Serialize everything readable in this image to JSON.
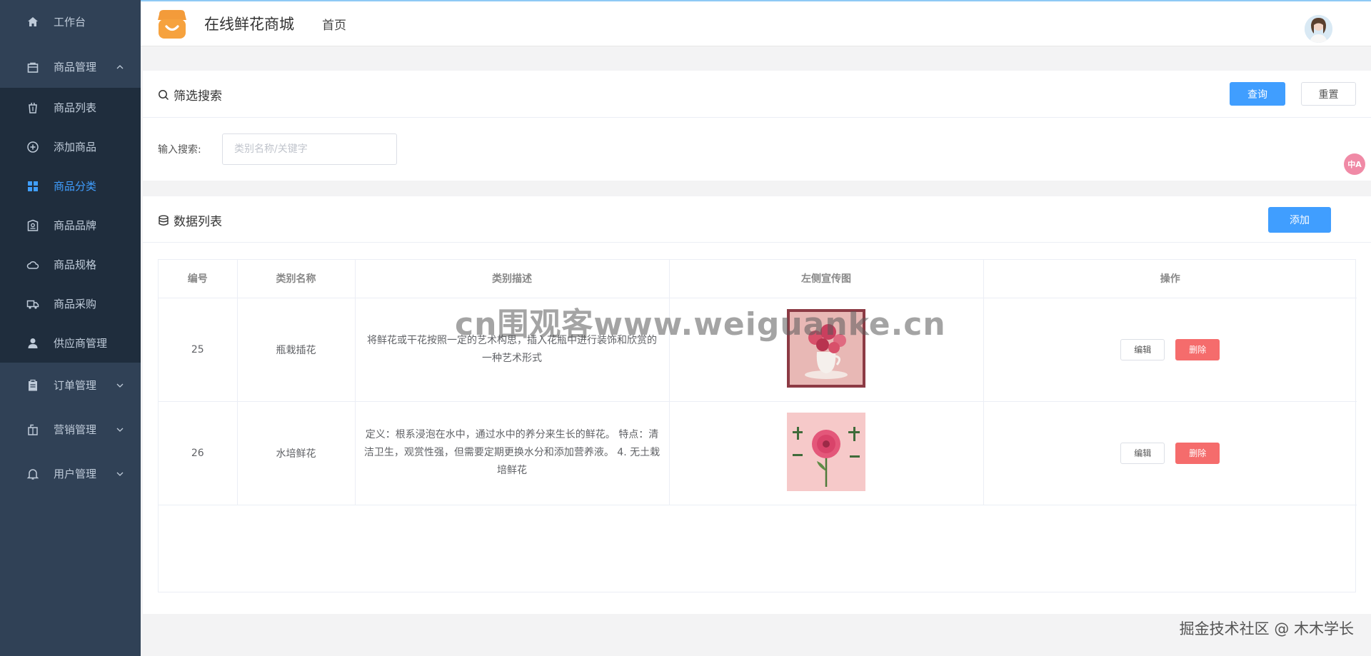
{
  "sidebar": {
    "top_items": [
      {
        "label": "工作台",
        "icon": "home-icon"
      },
      {
        "label": "商品管理",
        "icon": "shopping-bag-icon"
      }
    ],
    "sub_items": [
      {
        "label": "商品列表",
        "icon": "trash-bag-icon"
      },
      {
        "label": "添加商品",
        "icon": "plus-circle-icon"
      },
      {
        "label": "商品分类",
        "icon": "grid-icon",
        "active": true
      },
      {
        "label": "商品品牌",
        "icon": "badge-icon"
      },
      {
        "label": "商品规格",
        "icon": "cloud-icon"
      },
      {
        "label": "商品采购",
        "icon": "truck-icon"
      },
      {
        "label": "供应商管理",
        "icon": "user-icon"
      }
    ],
    "bottom_items": [
      {
        "label": "订单管理",
        "icon": "clipboard-icon"
      },
      {
        "label": "营销管理",
        "icon": "gift-icon"
      },
      {
        "label": "用户管理",
        "icon": "bell-icon"
      }
    ]
  },
  "header": {
    "brand": "在线鲜花商城",
    "home": "首页"
  },
  "search": {
    "title": "筛选搜索",
    "query_button": "查询",
    "reset_button": "重置",
    "label": "输入搜索:",
    "placeholder": "类别名称/关键字",
    "value": ""
  },
  "list": {
    "title": "数据列表",
    "add_button": "添加",
    "columns": [
      "编号",
      "类别名称",
      "类别描述",
      "左侧宣传图",
      "操作"
    ],
    "rows": [
      {
        "id": "25",
        "name": "瓶栽插花",
        "desc": "将鲜花或干花按照一定的艺术构思，插入花瓶中进行装饰和欣赏的一种艺术形式"
      },
      {
        "id": "26",
        "name": "水培鲜花",
        "desc": "定义：根系浸泡在水中，通过水中的养分来生长的鲜花。 特点：清洁卫生，观赏性强，但需要定期更换水分和添加营养液。 4. 无土栽培鲜花"
      }
    ],
    "edit_label": "编辑",
    "delete_label": "删除"
  },
  "overlay": {
    "watermark": "cn围观客www.weiguanke.cn",
    "credit": "掘金技术社区 @ 木木学长",
    "translate": "中A"
  },
  "colors": {
    "sidebar_bg": "#304156",
    "submenu_bg": "#1f2d3d",
    "primary": "#409eff",
    "danger": "#f56c6c"
  }
}
